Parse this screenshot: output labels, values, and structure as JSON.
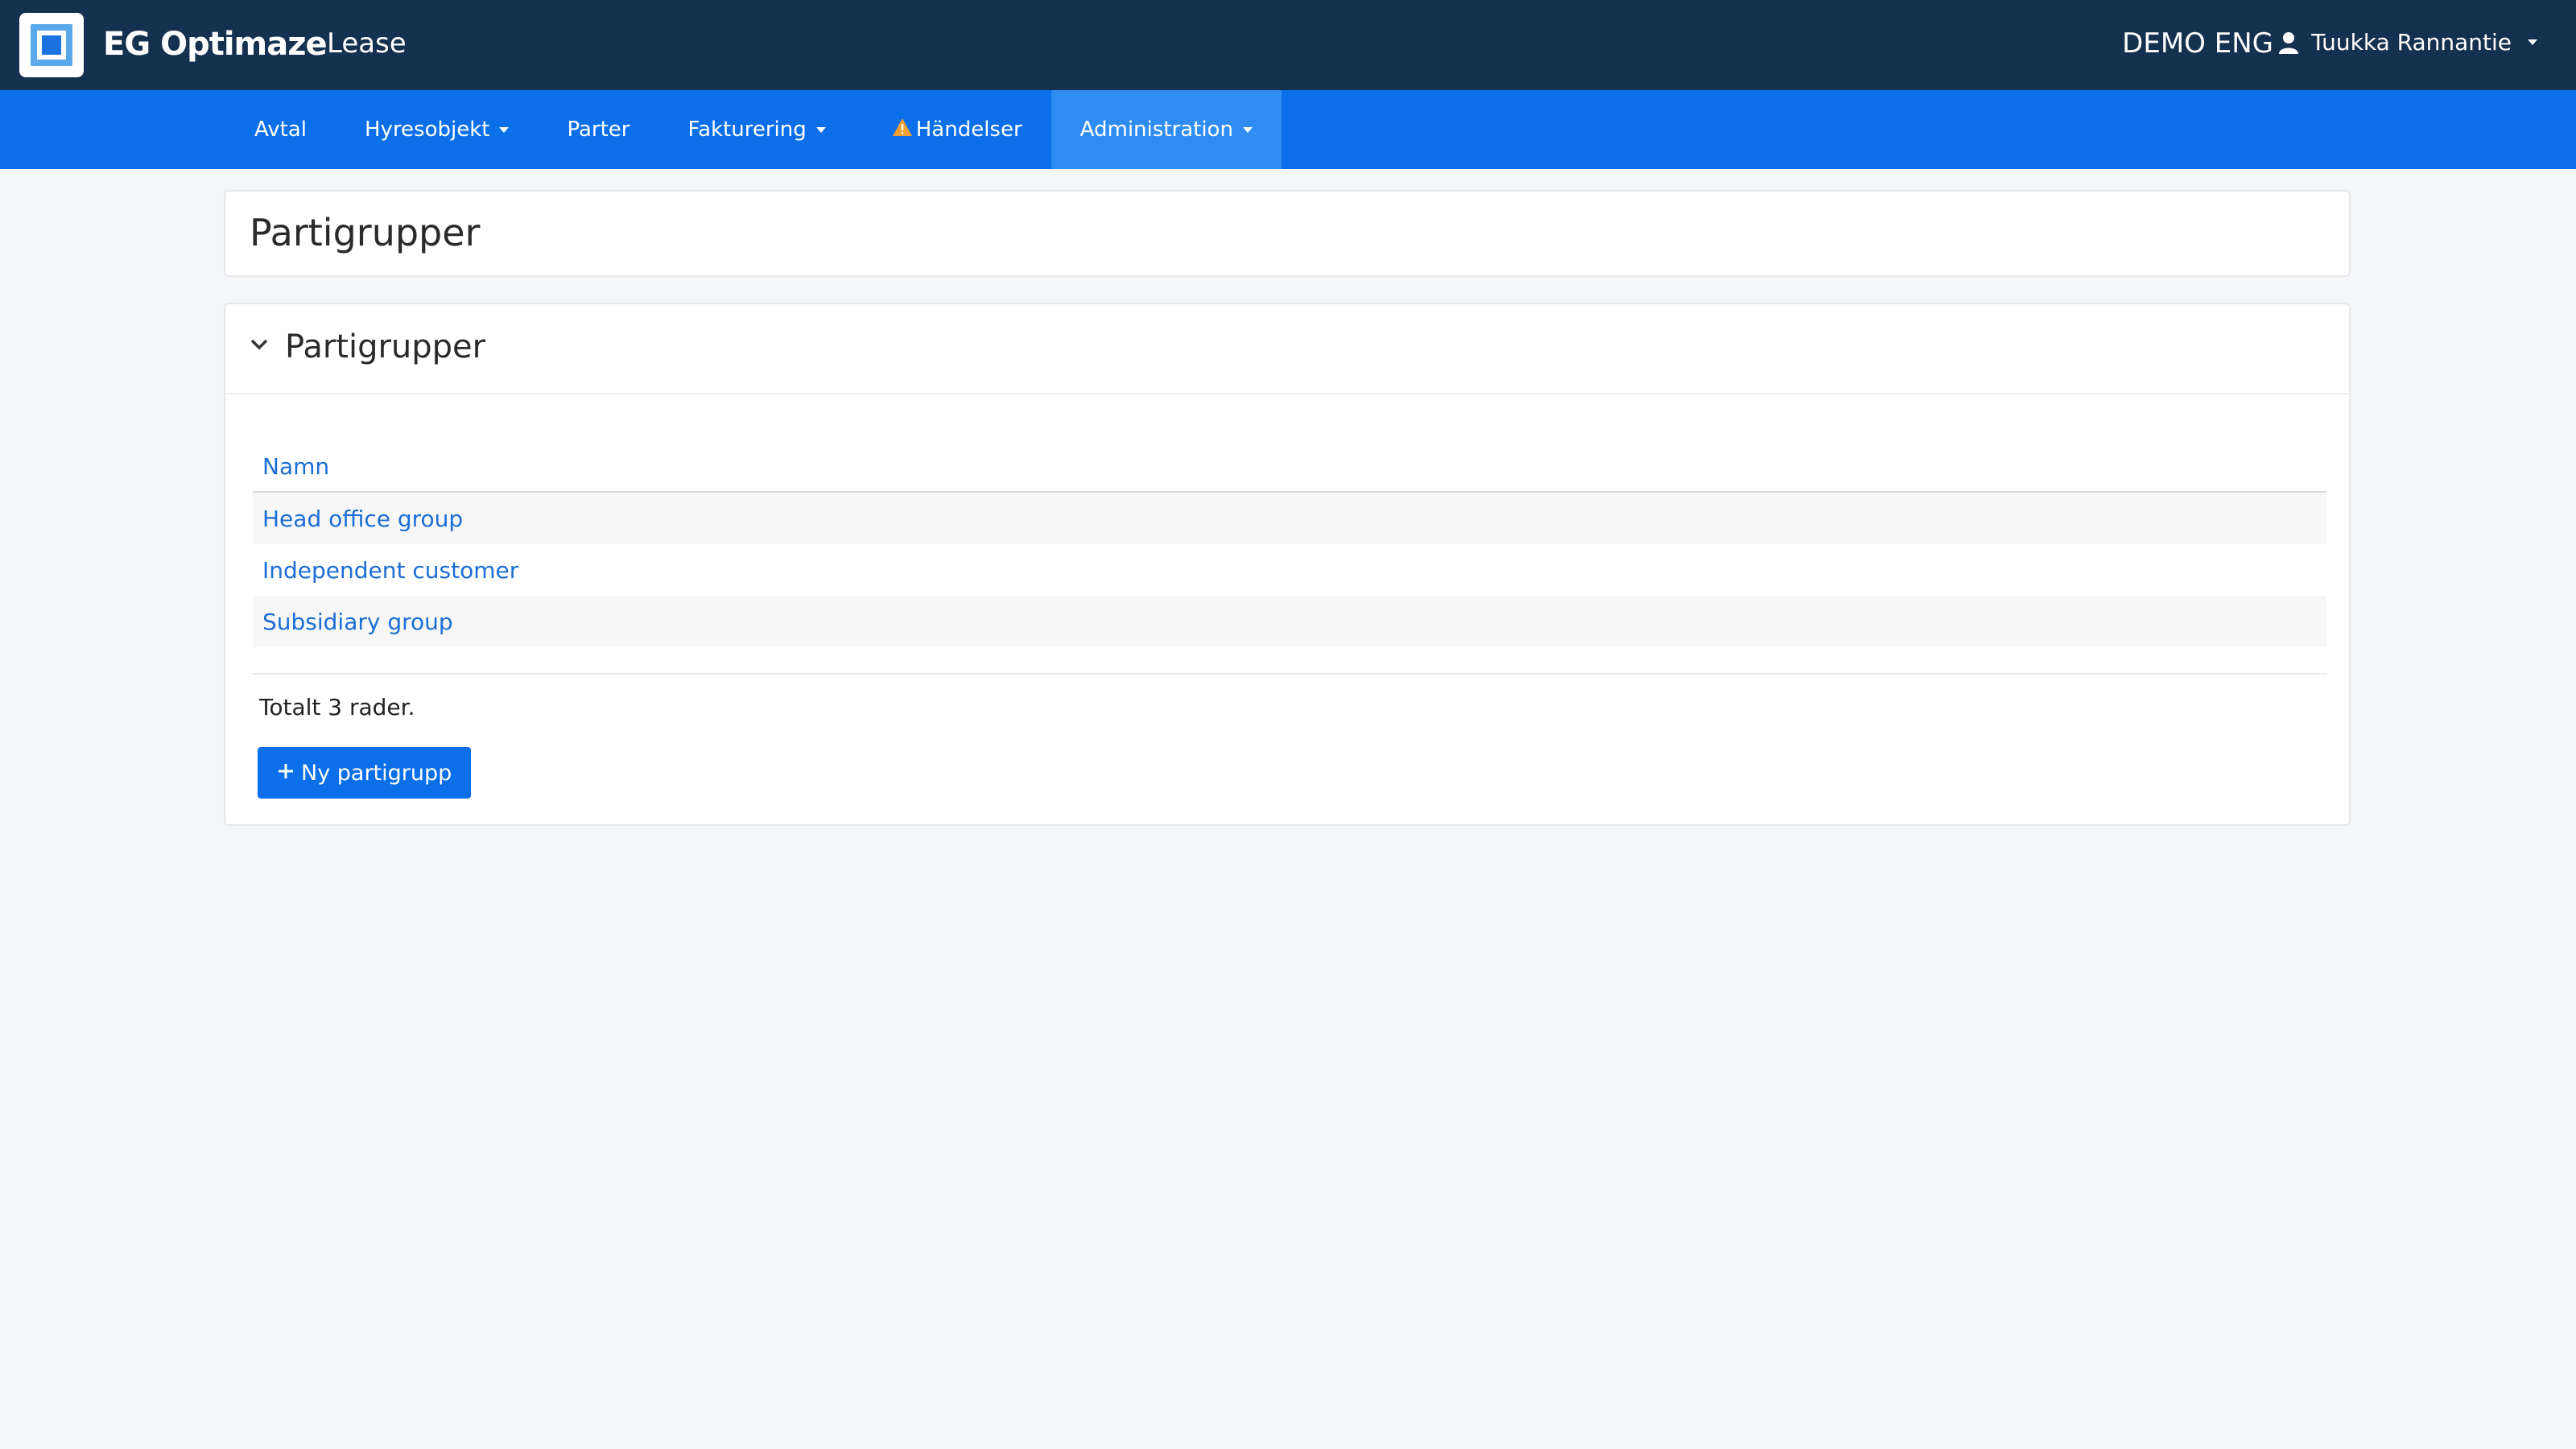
{
  "header": {
    "brand": "EG Optimaze",
    "module": "Lease",
    "environment": "DEMO ENG",
    "user_name": "Tuukka Rannantie"
  },
  "nav": {
    "items": [
      {
        "label": "Avtal",
        "dropdown": false
      },
      {
        "label": "Hyresobjekt",
        "dropdown": true
      },
      {
        "label": "Parter",
        "dropdown": false
      },
      {
        "label": "Fakturering",
        "dropdown": true
      },
      {
        "label": "Händelser",
        "dropdown": false,
        "warning": true
      },
      {
        "label": "Administration",
        "dropdown": true,
        "active": true
      }
    ]
  },
  "page": {
    "title": "Partigrupper"
  },
  "panel": {
    "title": "Partigrupper",
    "table": {
      "columns": [
        "Namn"
      ],
      "rows": [
        "Head office group",
        "Independent customer",
        "Subsidiary group"
      ]
    },
    "total_text": "Totalt 3 rader.",
    "new_button_label": "Ny partigrupp"
  },
  "colors": {
    "topbar": "#14324f",
    "navbar": "#0a6fe8",
    "nav_active": "#2f8cf2",
    "link": "#1b6ed6",
    "warning": "#f0a030"
  }
}
